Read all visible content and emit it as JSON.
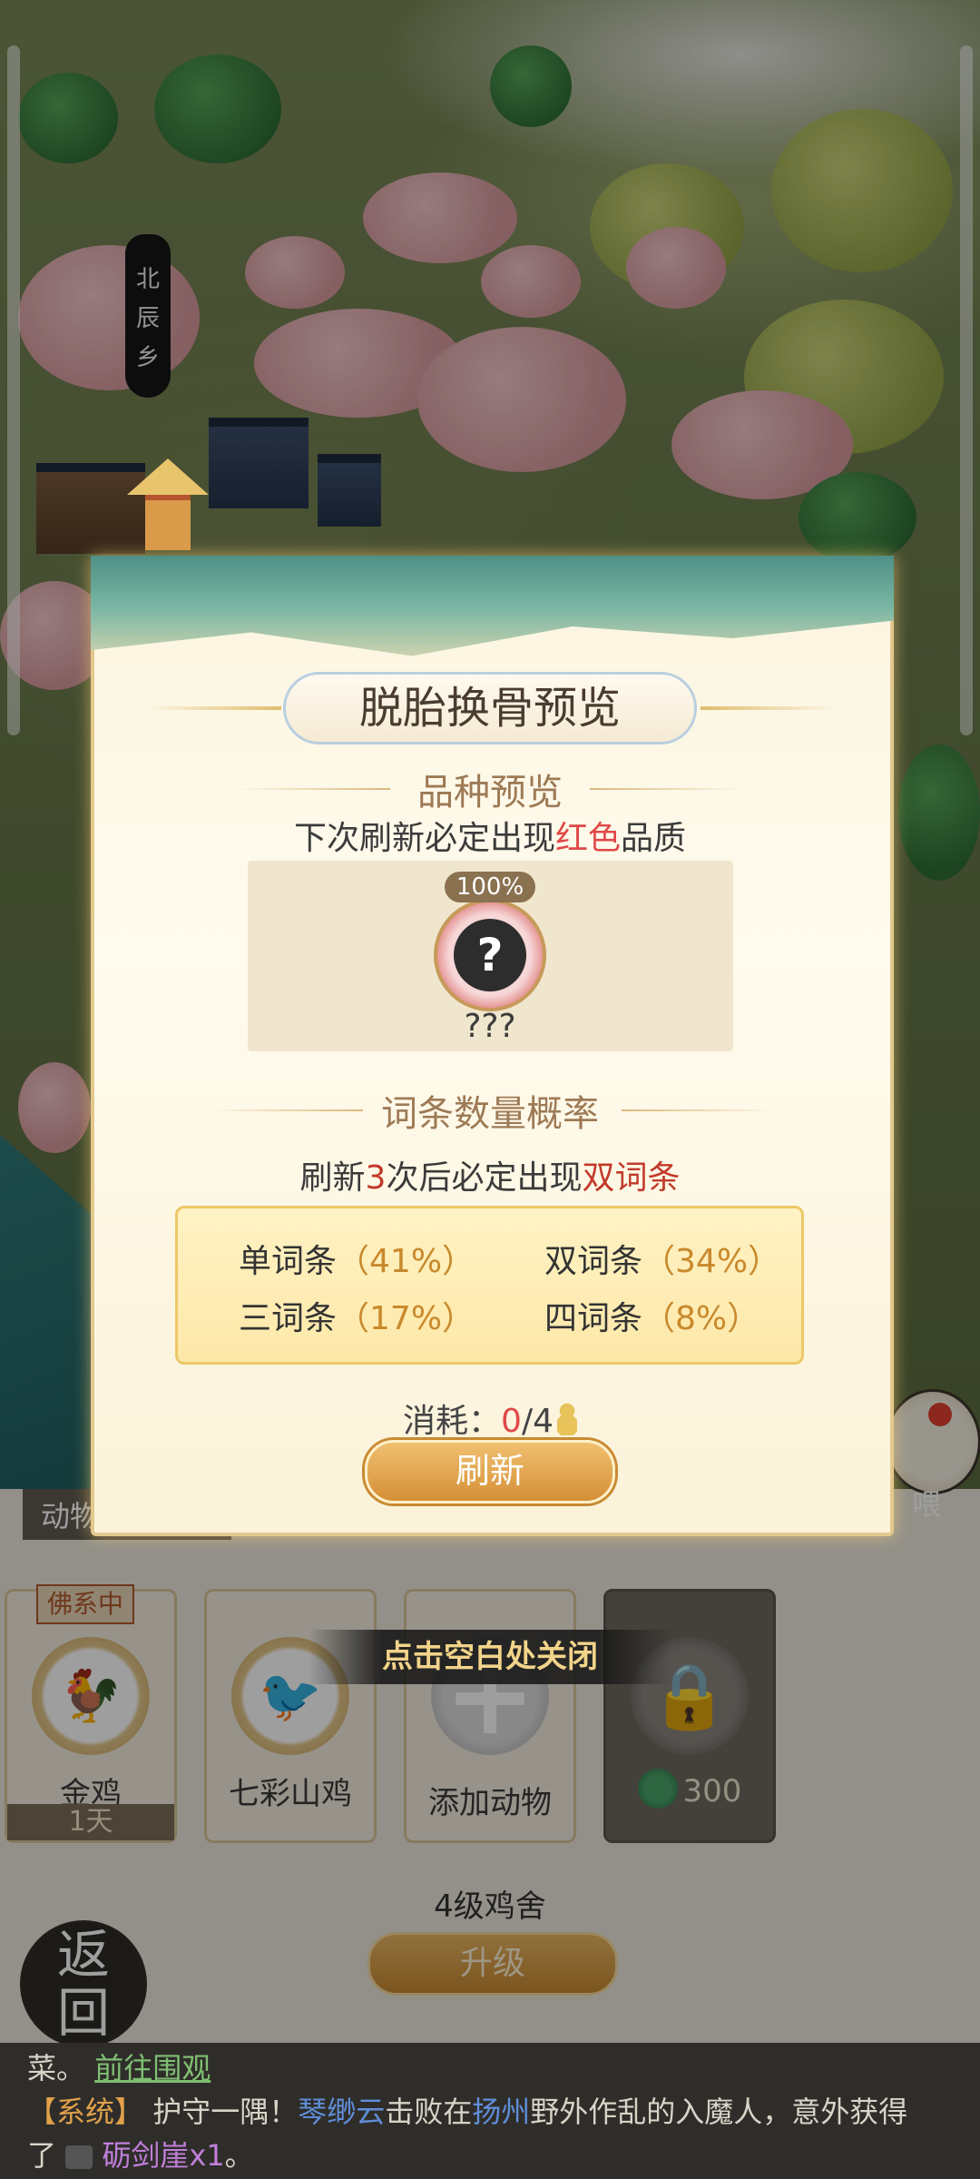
{
  "map": {
    "village_label_chars": [
      "北",
      "辰",
      "乡"
    ]
  },
  "dialog": {
    "title": "脱胎换骨预览",
    "variety_section": {
      "heading": "品种预览",
      "hint_prefix": "下次刷新必定出现",
      "hint_highlight": "红色",
      "hint_suffix": "品质",
      "preview": {
        "percent": "100%",
        "icon": "mystery-chicken-icon",
        "name": "???"
      }
    },
    "trait_section": {
      "heading": "词条数量概率",
      "hint_prefix": "刷新",
      "hint_count": "3",
      "hint_mid": "次后必定出现",
      "hint_highlight": "双词条",
      "probabilities": [
        {
          "label": "单词条",
          "pct": "（41%）"
        },
        {
          "label": "双词条",
          "pct": "（34%）"
        },
        {
          "label": "三词条",
          "pct": "（17%）"
        },
        {
          "label": "四词条",
          "pct": "（8%）"
        }
      ]
    },
    "cost": {
      "label": "消耗：",
      "current": "0",
      "total": "/4",
      "icon": "gourd-icon"
    },
    "refresh_button": "刷新"
  },
  "close_tip": "点击空白处关闭",
  "shop": {
    "strip_label": "动物数量：",
    "foxi_tag": "佛系中",
    "cards": [
      {
        "name": "金鸡",
        "sub": "1天",
        "icon": "golden-rooster-icon"
      },
      {
        "name": "七彩山鸡",
        "icon": "pheasant-icon"
      },
      {
        "name": "添加动物",
        "icon": "plus-icon"
      },
      {
        "cost": "300",
        "icon": "lock-icon",
        "currency_icon": "jade-coin-icon"
      }
    ],
    "coop_level": "4级鸡舍",
    "upgrade_button": "升级",
    "back_button_chars": [
      "返",
      "回"
    ],
    "feed_label": "喂"
  },
  "chat": {
    "line1_text": "菜。",
    "line1_link": "前往围观",
    "line2_tag": "【系统】",
    "line2_a": "护守一隅！",
    "line2_name": "琴缈云",
    "line2_b": "击败在",
    "line2_place": "扬州",
    "line2_c": "野外作乱的入魔人，意外获得",
    "line3_a": "了",
    "line3_item": "砺剑崖x1",
    "line3_end": "。"
  }
}
